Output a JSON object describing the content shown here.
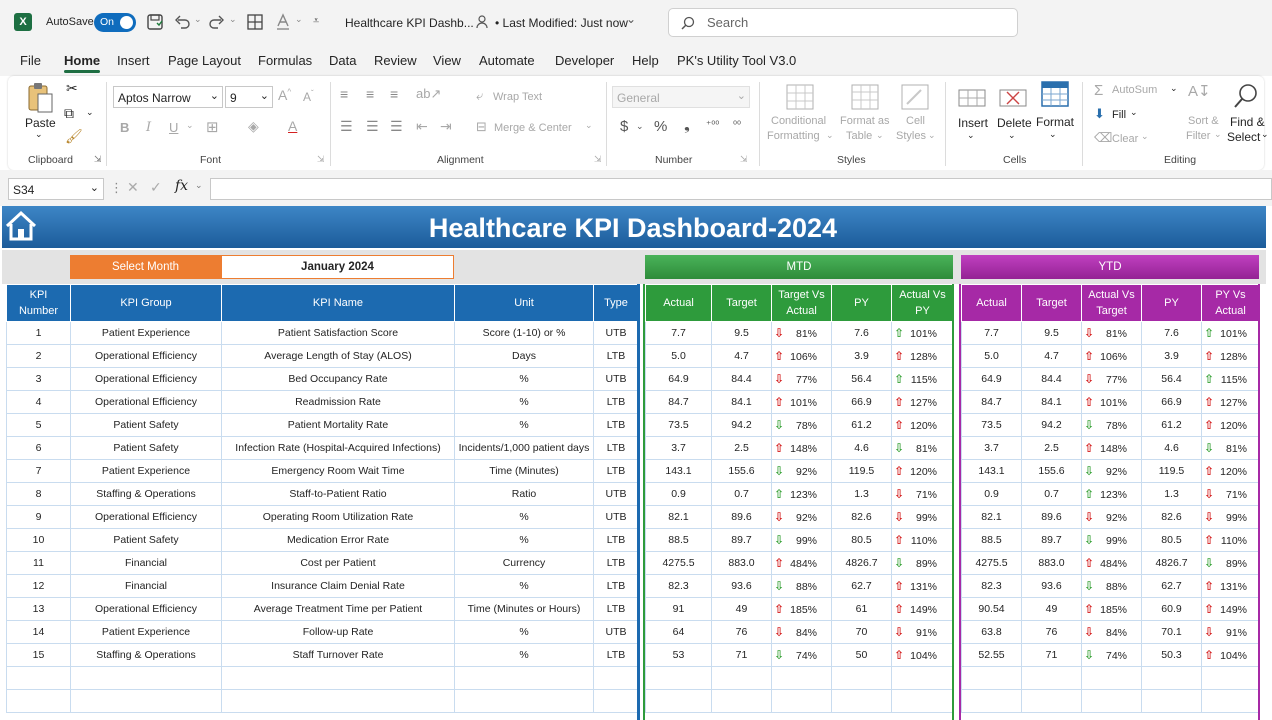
{
  "titlebar": {
    "autosave_label": "AutoSave",
    "autosave_state": "On",
    "filename": "Healthcare KPI Dashb...",
    "modified": "• Last Modified: Just now",
    "search_placeholder": "Search"
  },
  "menu": [
    "File",
    "Home",
    "Insert",
    "Page Layout",
    "Formulas",
    "Data",
    "Review",
    "View",
    "Automate",
    "Developer",
    "Help",
    "PK's Utility Tool V3.0"
  ],
  "ribbon": {
    "paste": "Paste",
    "clipboard": "Clipboard",
    "font_name": "Aptos Narrow",
    "font_size": "9",
    "font": "Font",
    "wrap_text": "Wrap Text",
    "merge_center": "Merge & Center",
    "alignment": "Alignment",
    "number_format": "General",
    "number": "Number",
    "conditional_formatting_1": "Conditional",
    "conditional_formatting_2": "Formatting",
    "format_as_table_1": "Format as",
    "format_as_table_2": "Table",
    "cell_styles_1": "Cell",
    "cell_styles_2": "Styles",
    "styles": "Styles",
    "insert": "Insert",
    "delete": "Delete",
    "format": "Format",
    "cells": "Cells",
    "autosum": "AutoSum",
    "fill": "Fill",
    "clear": "Clear",
    "sort_filter_1": "Sort &",
    "sort_filter_2": "Filter",
    "find_select_1": "Find &",
    "find_select_2": "Select",
    "editing": "Editing"
  },
  "formula_bar": {
    "name_box": "S34",
    "formula": ""
  },
  "dashboard": {
    "title": "Healthcare KPI Dashboard-2024",
    "select_month_label": "Select Month",
    "selected_month": "January 2024",
    "mtd_label": "MTD",
    "ytd_label": "YTD",
    "headers": {
      "kpi_number": [
        "KPI",
        "Number"
      ],
      "kpi_group": "KPI Group",
      "kpi_name": "KPI Name",
      "unit": "Unit",
      "type": "Type",
      "actual": "Actual",
      "target": "Target",
      "target_vs_actual": [
        "Target Vs",
        "Actual"
      ],
      "py": "PY",
      "actual_vs_py": [
        "Actual Vs",
        "PY"
      ],
      "actual_vs_target": [
        "Actual Vs",
        "Target"
      ],
      "py_vs_actual": [
        "PY Vs",
        "Actual"
      ]
    },
    "colors": {
      "banner": "#2a6fad",
      "blue_header": "#1c6ab0",
      "mtd": "#2e9b3c",
      "ytd": "#a629a6",
      "select_month": "#ed7d31"
    },
    "rows": [
      {
        "n": "1",
        "group": "Patient Experience",
        "name": "Patient Satisfaction Score",
        "unit": "Score (1-10) or %",
        "type": "UTB",
        "m_actual": "7.7",
        "m_target": "9.5",
        "m_tva": "81%",
        "m_tva_dir": "dn-r",
        "m_py": "7.6",
        "m_avp": "101%",
        "m_avp_dir": "up-g",
        "y_actual": "7.7",
        "y_target": "9.5",
        "y_avt": "81%",
        "y_avt_dir": "dn-r",
        "y_py": "7.6",
        "y_pva": "101%",
        "y_pva_dir": "up-g"
      },
      {
        "n": "2",
        "group": "Operational Efficiency",
        "name": "Average Length of Stay (ALOS)",
        "unit": "Days",
        "type": "LTB",
        "m_actual": "5.0",
        "m_target": "4.7",
        "m_tva": "106%",
        "m_tva_dir": "up-r",
        "m_py": "3.9",
        "m_avp": "128%",
        "m_avp_dir": "up-r",
        "y_actual": "5.0",
        "y_target": "4.7",
        "y_avt": "106%",
        "y_avt_dir": "up-r",
        "y_py": "3.9",
        "y_pva": "128%",
        "y_pva_dir": "up-r"
      },
      {
        "n": "3",
        "group": "Operational Efficiency",
        "name": "Bed Occupancy Rate",
        "unit": "%",
        "type": "UTB",
        "m_actual": "64.9",
        "m_target": "84.4",
        "m_tva": "77%",
        "m_tva_dir": "dn-r",
        "m_py": "56.4",
        "m_avp": "115%",
        "m_avp_dir": "up-g",
        "y_actual": "64.9",
        "y_target": "84.4",
        "y_avt": "77%",
        "y_avt_dir": "dn-r",
        "y_py": "56.4",
        "y_pva": "115%",
        "y_pva_dir": "up-g"
      },
      {
        "n": "4",
        "group": "Operational Efficiency",
        "name": "Readmission Rate",
        "unit": "%",
        "type": "LTB",
        "m_actual": "84.7",
        "m_target": "84.1",
        "m_tva": "101%",
        "m_tva_dir": "up-r",
        "m_py": "66.9",
        "m_avp": "127%",
        "m_avp_dir": "up-r",
        "y_actual": "84.7",
        "y_target": "84.1",
        "y_avt": "101%",
        "y_avt_dir": "up-r",
        "y_py": "66.9",
        "y_pva": "127%",
        "y_pva_dir": "up-r"
      },
      {
        "n": "5",
        "group": "Patient Safety",
        "name": "Patient Mortality Rate",
        "unit": "%",
        "type": "LTB",
        "m_actual": "73.5",
        "m_target": "94.2",
        "m_tva": "78%",
        "m_tva_dir": "dn-g",
        "m_py": "61.2",
        "m_avp": "120%",
        "m_avp_dir": "up-r",
        "y_actual": "73.5",
        "y_target": "94.2",
        "y_avt": "78%",
        "y_avt_dir": "dn-g",
        "y_py": "61.2",
        "y_pva": "120%",
        "y_pva_dir": "up-r"
      },
      {
        "n": "6",
        "group": "Patient Safety",
        "name": "Infection Rate (Hospital-Acquired Infections)",
        "unit": "Incidents/1,000 patient days",
        "type": "LTB",
        "m_actual": "3.7",
        "m_target": "2.5",
        "m_tva": "148%",
        "m_tva_dir": "up-r",
        "m_py": "4.6",
        "m_avp": "81%",
        "m_avp_dir": "dn-g",
        "y_actual": "3.7",
        "y_target": "2.5",
        "y_avt": "148%",
        "y_avt_dir": "up-r",
        "y_py": "4.6",
        "y_pva": "81%",
        "y_pva_dir": "dn-g"
      },
      {
        "n": "7",
        "group": "Patient Experience",
        "name": "Emergency Room Wait Time",
        "unit": "Time (Minutes)",
        "type": "LTB",
        "m_actual": "143.1",
        "m_target": "155.6",
        "m_tva": "92%",
        "m_tva_dir": "dn-g",
        "m_py": "119.5",
        "m_avp": "120%",
        "m_avp_dir": "up-r",
        "y_actual": "143.1",
        "y_target": "155.6",
        "y_avt": "92%",
        "y_avt_dir": "dn-g",
        "y_py": "119.5",
        "y_pva": "120%",
        "y_pva_dir": "up-r"
      },
      {
        "n": "8",
        "group": "Staffing & Operations",
        "name": "Staff-to-Patient Ratio",
        "unit": "Ratio",
        "type": "UTB",
        "m_actual": "0.9",
        "m_target": "0.7",
        "m_tva": "123%",
        "m_tva_dir": "up-g",
        "m_py": "1.3",
        "m_avp": "71%",
        "m_avp_dir": "dn-r",
        "y_actual": "0.9",
        "y_target": "0.7",
        "y_avt": "123%",
        "y_avt_dir": "up-g",
        "y_py": "1.3",
        "y_pva": "71%",
        "y_pva_dir": "dn-r"
      },
      {
        "n": "9",
        "group": "Operational Efficiency",
        "name": "Operating Room Utilization Rate",
        "unit": "%",
        "type": "UTB",
        "m_actual": "82.1",
        "m_target": "89.6",
        "m_tva": "92%",
        "m_tva_dir": "dn-r",
        "m_py": "82.6",
        "m_avp": "99%",
        "m_avp_dir": "dn-r",
        "y_actual": "82.1",
        "y_target": "89.6",
        "y_avt": "92%",
        "y_avt_dir": "dn-r",
        "y_py": "82.6",
        "y_pva": "99%",
        "y_pva_dir": "dn-r"
      },
      {
        "n": "10",
        "group": "Patient Safety",
        "name": "Medication Error Rate",
        "unit": "%",
        "type": "LTB",
        "m_actual": "88.5",
        "m_target": "89.7",
        "m_tva": "99%",
        "m_tva_dir": "dn-g",
        "m_py": "80.5",
        "m_avp": "110%",
        "m_avp_dir": "up-r",
        "y_actual": "88.5",
        "y_target": "89.7",
        "y_avt": "99%",
        "y_avt_dir": "dn-g",
        "y_py": "80.5",
        "y_pva": "110%",
        "y_pva_dir": "up-r"
      },
      {
        "n": "11",
        "group": "Financial",
        "name": "Cost per Patient",
        "unit": "Currency",
        "type": "LTB",
        "m_actual": "4275.5",
        "m_target": "883.0",
        "m_tva": "484%",
        "m_tva_dir": "up-r",
        "m_py": "4826.7",
        "m_avp": "89%",
        "m_avp_dir": "dn-g",
        "y_actual": "4275.5",
        "y_target": "883.0",
        "y_avt": "484%",
        "y_avt_dir": "up-r",
        "y_py": "4826.7",
        "y_pva": "89%",
        "y_pva_dir": "dn-g"
      },
      {
        "n": "12",
        "group": "Financial",
        "name": "Insurance Claim Denial Rate",
        "unit": "%",
        "type": "LTB",
        "m_actual": "82.3",
        "m_target": "93.6",
        "m_tva": "88%",
        "m_tva_dir": "dn-g",
        "m_py": "62.7",
        "m_avp": "131%",
        "m_avp_dir": "up-r",
        "y_actual": "82.3",
        "y_target": "93.6",
        "y_avt": "88%",
        "y_avt_dir": "dn-g",
        "y_py": "62.7",
        "y_pva": "131%",
        "y_pva_dir": "up-r"
      },
      {
        "n": "13",
        "group": "Operational Efficiency",
        "name": "Average Treatment Time per Patient",
        "unit": "Time (Minutes or Hours)",
        "type": "LTB",
        "m_actual": "91",
        "m_target": "49",
        "m_tva": "185%",
        "m_tva_dir": "up-r",
        "m_py": "61",
        "m_avp": "149%",
        "m_avp_dir": "up-r",
        "y_actual": "90.54",
        "y_target": "49",
        "y_avt": "185%",
        "y_avt_dir": "up-r",
        "y_py": "60.9",
        "y_pva": "149%",
        "y_pva_dir": "up-r"
      },
      {
        "n": "14",
        "group": "Patient Experience",
        "name": "Follow-up Rate",
        "unit": "%",
        "type": "UTB",
        "m_actual": "64",
        "m_target": "76",
        "m_tva": "84%",
        "m_tva_dir": "dn-r",
        "m_py": "70",
        "m_avp": "91%",
        "m_avp_dir": "dn-r",
        "y_actual": "63.8",
        "y_target": "76",
        "y_avt": "84%",
        "y_avt_dir": "dn-r",
        "y_py": "70.1",
        "y_pva": "91%",
        "y_pva_dir": "dn-r"
      },
      {
        "n": "15",
        "group": "Staffing & Operations",
        "name": "Staff Turnover Rate",
        "unit": "%",
        "type": "LTB",
        "m_actual": "53",
        "m_target": "71",
        "m_tva": "74%",
        "m_tva_dir": "dn-g",
        "m_py": "50",
        "m_avp": "104%",
        "m_avp_dir": "up-r",
        "y_actual": "52.55",
        "y_target": "71",
        "y_avt": "74%",
        "y_avt_dir": "dn-g",
        "y_py": "50.3",
        "y_pva": "104%",
        "y_pva_dir": "up-r"
      }
    ]
  }
}
